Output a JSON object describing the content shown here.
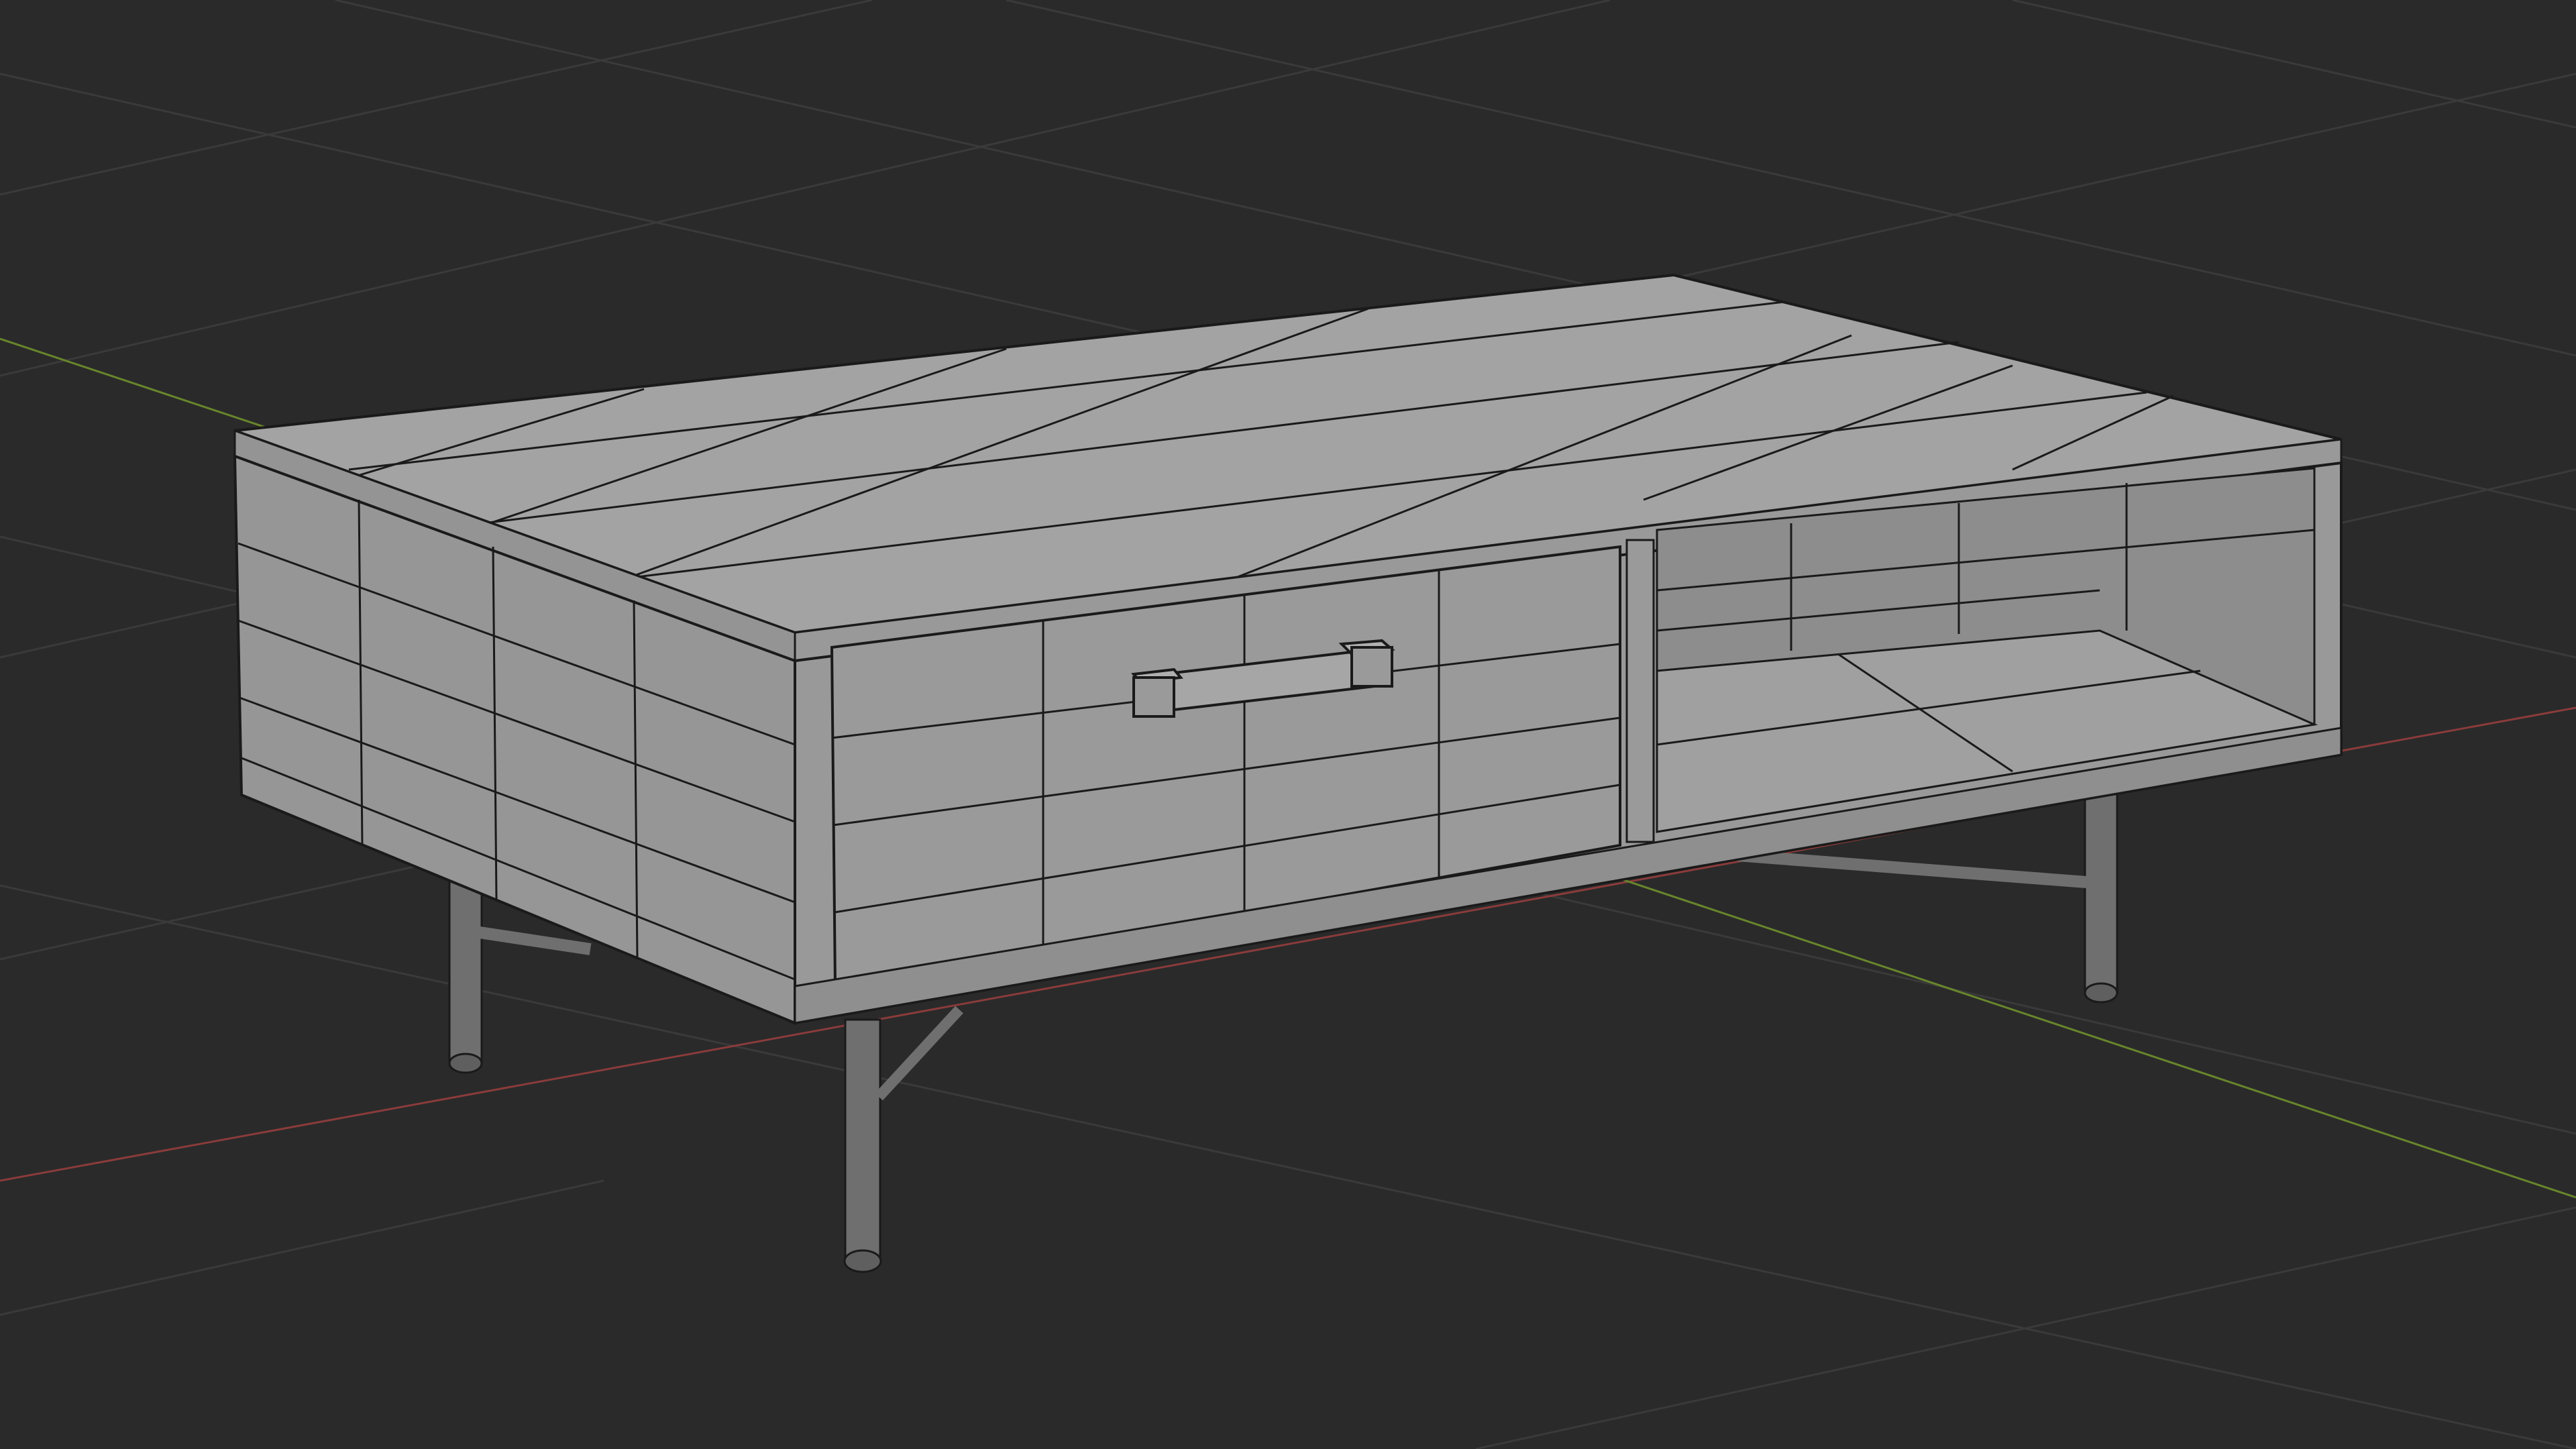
{
  "viewport": {
    "background": "#2a2a2a",
    "grid_color": "#3d3d3d",
    "x_axis_color": "#8a3a3a",
    "y_axis_color": "#6a8a2a",
    "wire_color": "#1a1a1a",
    "face_top": "#a2a2a2",
    "face_front": "#9b9b9b",
    "face_side": "#959595",
    "face_inner": "#8c8c8c",
    "leg_color": "#6f6f6f"
  },
  "scene": {
    "object": "coffee-table",
    "shading": "solid-wireframe"
  }
}
